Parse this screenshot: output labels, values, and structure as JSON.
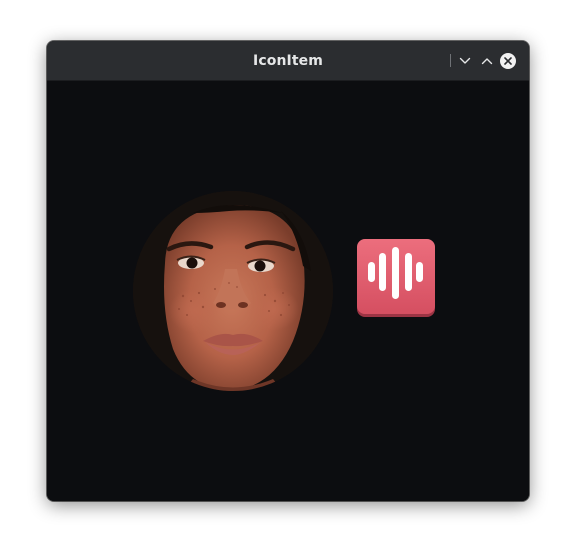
{
  "window": {
    "title": "IconItem"
  },
  "titlebar": {
    "buttons": [
      {
        "name": "minimize",
        "icon": "chevron-down-icon"
      },
      {
        "name": "maximize",
        "icon": "chevron-up-icon"
      },
      {
        "name": "close",
        "icon": "close-icon"
      }
    ]
  },
  "content": {
    "avatar": {
      "icon": "person-photo"
    },
    "app_icon": {
      "icon": "audio-waveform-icon",
      "color": "#e05a6b"
    }
  },
  "colors": {
    "titlebar": "#2b2d30",
    "background": "#0c0d10",
    "title_text": "#e6e7e8",
    "app_icon_red": "#e05a6b"
  }
}
